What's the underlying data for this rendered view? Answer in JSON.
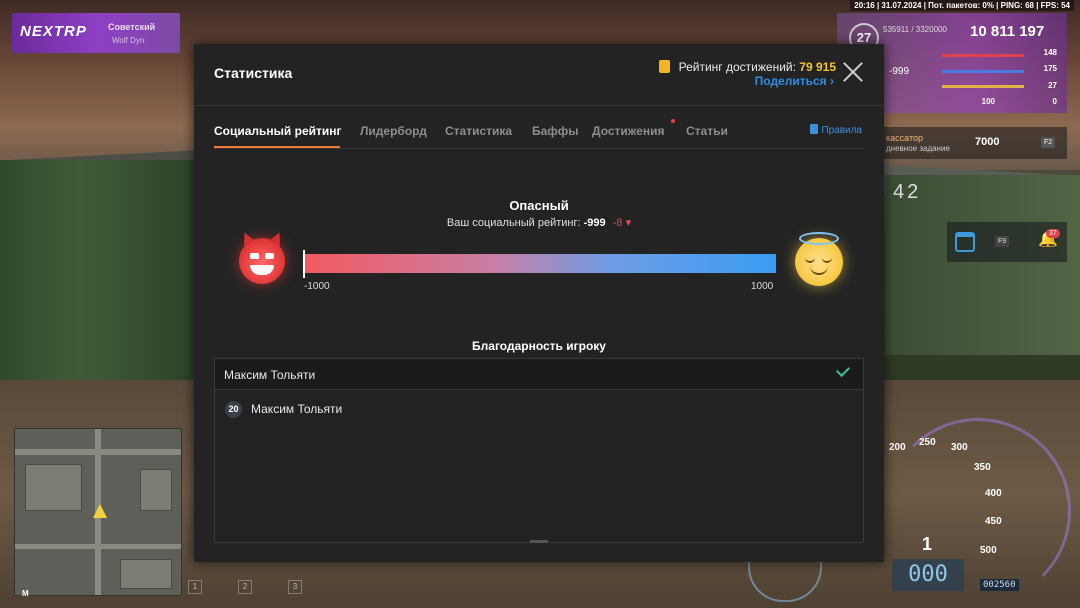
{
  "hud": {
    "top_info": "20:16 | 31.07.2024 | Пот. пакетов: 0% | PING: 68 | FPS: 54",
    "server_brand": "NEXTRP",
    "server_name": "Советский",
    "server_sub": "Wolf Dyn",
    "level": "27",
    "xp": "535911 / 3320000",
    "money": "10 811 197",
    "health": "148",
    "armor": "175",
    "hunger": "27",
    "wanted": "0",
    "small_rating": "-999",
    "small_stat": "100",
    "job_name": "кассатор",
    "job_sub": "дневное задание",
    "job_price": "7000",
    "job_key": "F2",
    "big_number": "42",
    "quick_key": "F9",
    "notif_count": "37",
    "minimap_label": "M",
    "slots": [
      "1",
      "2",
      "3"
    ],
    "speed_scale": [
      "200",
      "250",
      "300",
      "350",
      "400",
      "450",
      "500"
    ],
    "gear": "1",
    "speed_digits": "000",
    "odometer": "002560"
  },
  "dialog": {
    "title": "Статистика",
    "achievement_label": "Рейтинг достижений:",
    "achievement_value": "79 915",
    "share_label": "Поделиться ›",
    "tabs": [
      {
        "label": "Социальный рейтинг"
      },
      {
        "label": "Лидерборд"
      },
      {
        "label": "Статистика"
      },
      {
        "label": "Баффы"
      },
      {
        "label": "Достижения"
      },
      {
        "label": "Статьи"
      }
    ],
    "rules_label": "Правила",
    "status_title": "Опасный",
    "rating_label": "Ваш социальный рейтинг:",
    "rating_value": "-999",
    "rating_delta": "-8 ▾",
    "rating_fraction": 0.0005,
    "scale_min": "-1000",
    "scale_max": "1000",
    "gratitude_title": "Благодарность игроку",
    "selected_player": "Максим Тольяти",
    "players": [
      {
        "id": "20",
        "name": "Максим Тольяти"
      }
    ]
  }
}
